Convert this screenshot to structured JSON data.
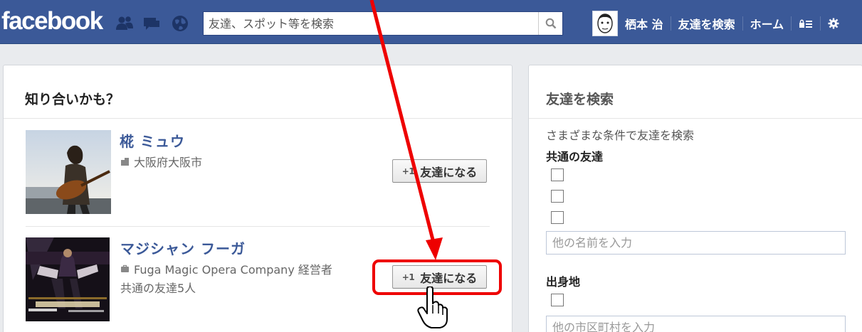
{
  "topbar": {
    "logo": "facebook",
    "search_placeholder": "友達、スポット等を検索",
    "user_name": "栖本 治",
    "find_friends": "友達を検索",
    "home": "ホーム",
    "icons": [
      "friend-requests-icon",
      "messages-icon",
      "notifications-globe-icon",
      "search-icon",
      "privacy-shortcut-icon",
      "settings-gear-icon"
    ]
  },
  "pymk": {
    "title": "知り合いかも？",
    "people": [
      {
        "name": "椛 ミュウ",
        "location": "大阪府大阪市",
        "button": "友達になる",
        "plus": "+1"
      },
      {
        "name": "マジシャン フーガ",
        "work": "Fuga Magic Opera Company 経営者",
        "mutual": "共通の友達5人",
        "button": "友達になる",
        "plus": "+1"
      }
    ]
  },
  "find_friends_panel": {
    "title": "友達を検索",
    "subtitle": "さまざまな条件で友達を検索",
    "mutual_heading": "共通の友達",
    "other_name_placeholder": "他の名前を入力",
    "hometown_heading": "出身地",
    "city_placeholder": "他の市区町村を入力"
  },
  "colors": {
    "brand": "#3b5998",
    "annotation_red": "#ee0000"
  }
}
